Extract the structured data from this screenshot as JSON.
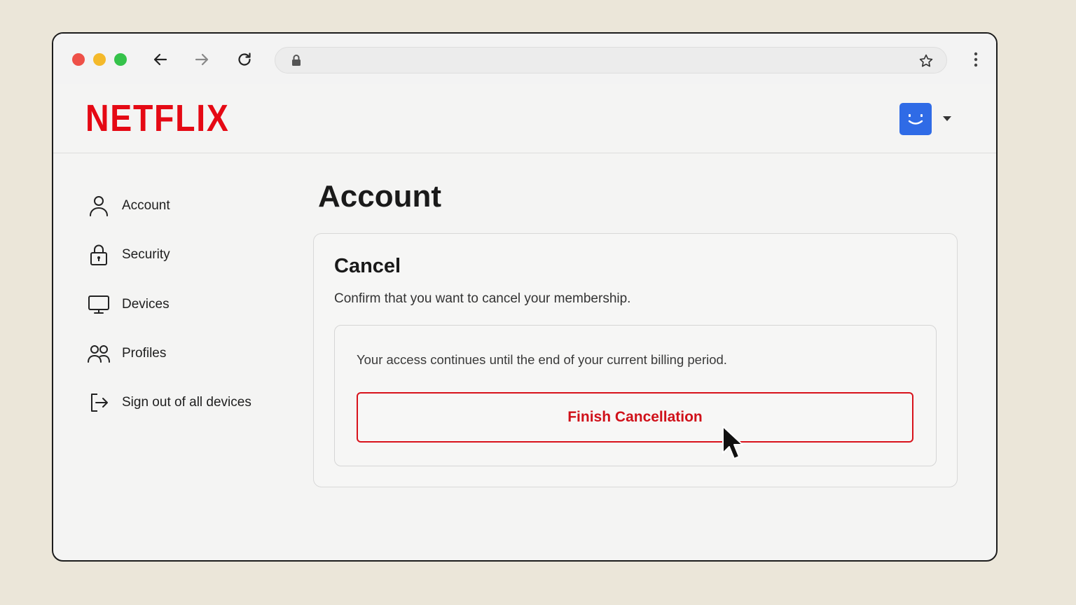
{
  "brand": {
    "logo_text": "NETFLIX",
    "accent": "#e50914"
  },
  "browser": {
    "icons": [
      "close-dot",
      "minimize-dot",
      "maximize-dot",
      "back-arrow-icon",
      "forward-arrow-icon",
      "reload-icon",
      "lock-icon",
      "star-icon",
      "kebab-menu-icon"
    ],
    "url": ""
  },
  "header": {
    "avatar_color": "#2f6be6"
  },
  "sidebar": {
    "items": [
      {
        "label": "Account",
        "icon": "person-icon"
      },
      {
        "label": "Security",
        "icon": "lock-icon"
      },
      {
        "label": "Devices",
        "icon": "monitor-icon"
      },
      {
        "label": "Profiles",
        "icon": "people-icon"
      },
      {
        "label": "Sign out of all devices",
        "icon": "sign-out-icon"
      }
    ]
  },
  "main": {
    "title": "Account",
    "card": {
      "title": "Cancel",
      "description": "Confirm that you want to cancel your membership.",
      "notice": "Your access continues until the end of your current billing period.",
      "button_label": "Finish Cancellation"
    }
  }
}
